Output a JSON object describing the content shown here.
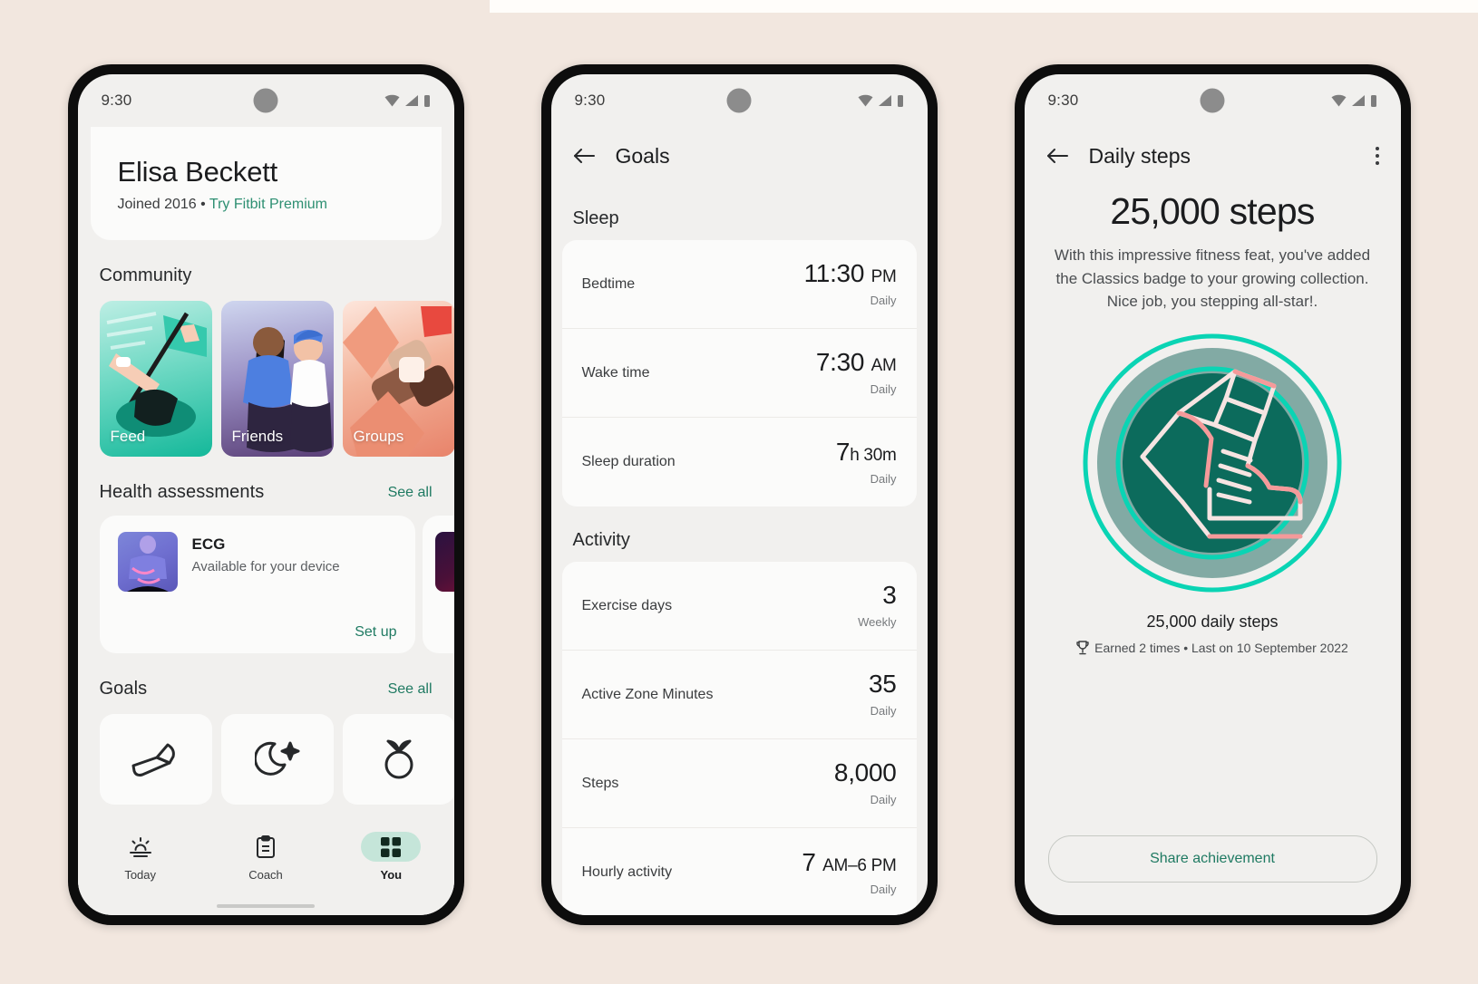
{
  "background": {
    "page_color": "#f2e7df",
    "strip_color": "#fffdfa"
  },
  "accent": {
    "green": "#1f7a62",
    "teal_badge": "#0bbfa5",
    "pill": "#c5e5d9"
  },
  "phone1": {
    "status": {
      "time": "9:30",
      "wifi_icon": "wifi-icon",
      "signal_icon": "signal-icon",
      "battery_icon": "battery-icon"
    },
    "profile": {
      "name": "Elisa Beckett",
      "joined": "Joined 2016",
      "separator": "•",
      "premium_link": "Try Fitbit Premium"
    },
    "community": {
      "title": "Community",
      "cards": [
        {
          "label": "Feed",
          "art": "rowing-illustration"
        },
        {
          "label": "Friends",
          "art": "two-runners-illustration"
        },
        {
          "label": "Groups",
          "art": "abstract-hands-illustration"
        }
      ]
    },
    "health_assessments": {
      "title": "Health assessments",
      "see_all": "See all",
      "items": [
        {
          "name": "ECG",
          "status": "Available for your device",
          "action": "Set up"
        }
      ]
    },
    "goals": {
      "title": "Goals",
      "see_all": "See all",
      "tiles": [
        {
          "icon": "shoe-icon"
        },
        {
          "icon": "moon-sleep-icon"
        },
        {
          "icon": "apple-nutrition-icon"
        }
      ]
    },
    "bottom_nav": [
      {
        "label": "Today",
        "icon": "sunrise-icon",
        "active": false
      },
      {
        "label": "Coach",
        "icon": "clipboard-icon",
        "active": false
      },
      {
        "label": "You",
        "icon": "grid-icon",
        "active": true
      }
    ]
  },
  "phone2": {
    "status": {
      "time": "9:30"
    },
    "appbar": {
      "back_icon": "back-arrow-icon",
      "title": "Goals"
    },
    "sections": [
      {
        "title": "Sleep",
        "rows": [
          {
            "label": "Bedtime",
            "value": "11:30",
            "unit": "PM",
            "frequency": "Daily"
          },
          {
            "label": "Wake time",
            "value": "7:30",
            "unit": "AM",
            "frequency": "Daily"
          },
          {
            "label": "Sleep duration",
            "value": "7",
            "unit": "h 30m",
            "frequency": "Daily"
          }
        ]
      },
      {
        "title": "Activity",
        "rows": [
          {
            "label": "Exercise days",
            "value": "3",
            "unit": "",
            "frequency": "Weekly"
          },
          {
            "label": "Active Zone Minutes",
            "value": "35",
            "unit": "",
            "frequency": "Daily"
          },
          {
            "label": "Steps",
            "value": "8,000",
            "unit": "",
            "frequency": "Daily"
          },
          {
            "label": "Hourly activity",
            "value": "7",
            "unit": "AM–6 PM",
            "frequency": "Daily"
          }
        ]
      }
    ]
  },
  "phone3": {
    "status": {
      "time": "9:30"
    },
    "appbar": {
      "back_icon": "back-arrow-icon",
      "title": "Daily steps",
      "overflow_icon": "more-vertical-icon"
    },
    "achievement": {
      "headline": "25,000 steps",
      "description": "With this impressive fitness feat, you've added the Classics badge to your growing collection. Nice job, you stepping all-star!.",
      "badge_icon": "sneaker-badge-icon",
      "caption": "25,000 daily steps",
      "trophy_icon": "trophy-icon",
      "meta": "Earned 2 times • Last on 10 September 2022",
      "share_button": "Share achievement"
    }
  }
}
